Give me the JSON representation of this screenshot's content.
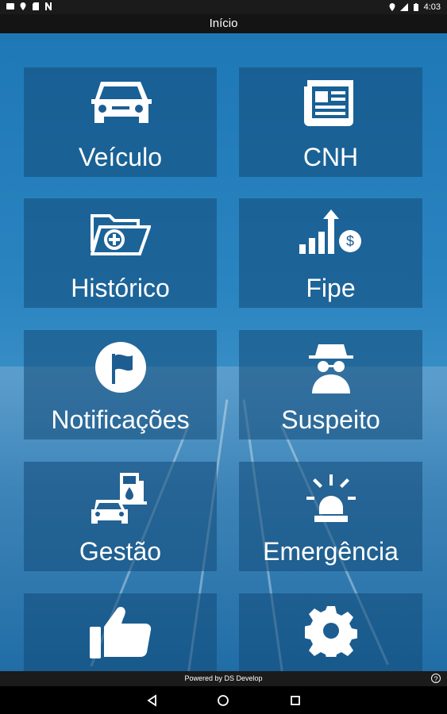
{
  "status_bar": {
    "time": "4:03",
    "left_icons": [
      "image-icon",
      "location-icon",
      "sd-card-icon",
      "n-icon"
    ],
    "right_icons": [
      "location-icon",
      "signal-icon",
      "battery-icon"
    ]
  },
  "header": {
    "title": "Início"
  },
  "tiles": [
    {
      "label": "Veículo",
      "icon": "car-icon"
    },
    {
      "label": "CNH",
      "icon": "newspaper-icon"
    },
    {
      "label": "Histórico",
      "icon": "folder-add-icon"
    },
    {
      "label": "Fipe",
      "icon": "price-chart-icon"
    },
    {
      "label": "Notificações",
      "icon": "flag-icon"
    },
    {
      "label": "Suspeito",
      "icon": "spy-icon"
    },
    {
      "label": "Gestão",
      "icon": "fuel-car-icon"
    },
    {
      "label": "Emergência",
      "icon": "siren-icon"
    },
    {
      "label": "",
      "icon": "thumbs-up-icon"
    },
    {
      "label": "",
      "icon": "gear-icon"
    }
  ],
  "footer": {
    "powered_by": "Powered by DS Develop",
    "help": "?"
  },
  "nav": {
    "back": "back-icon",
    "home": "home-icon",
    "recents": "recents-icon"
  }
}
